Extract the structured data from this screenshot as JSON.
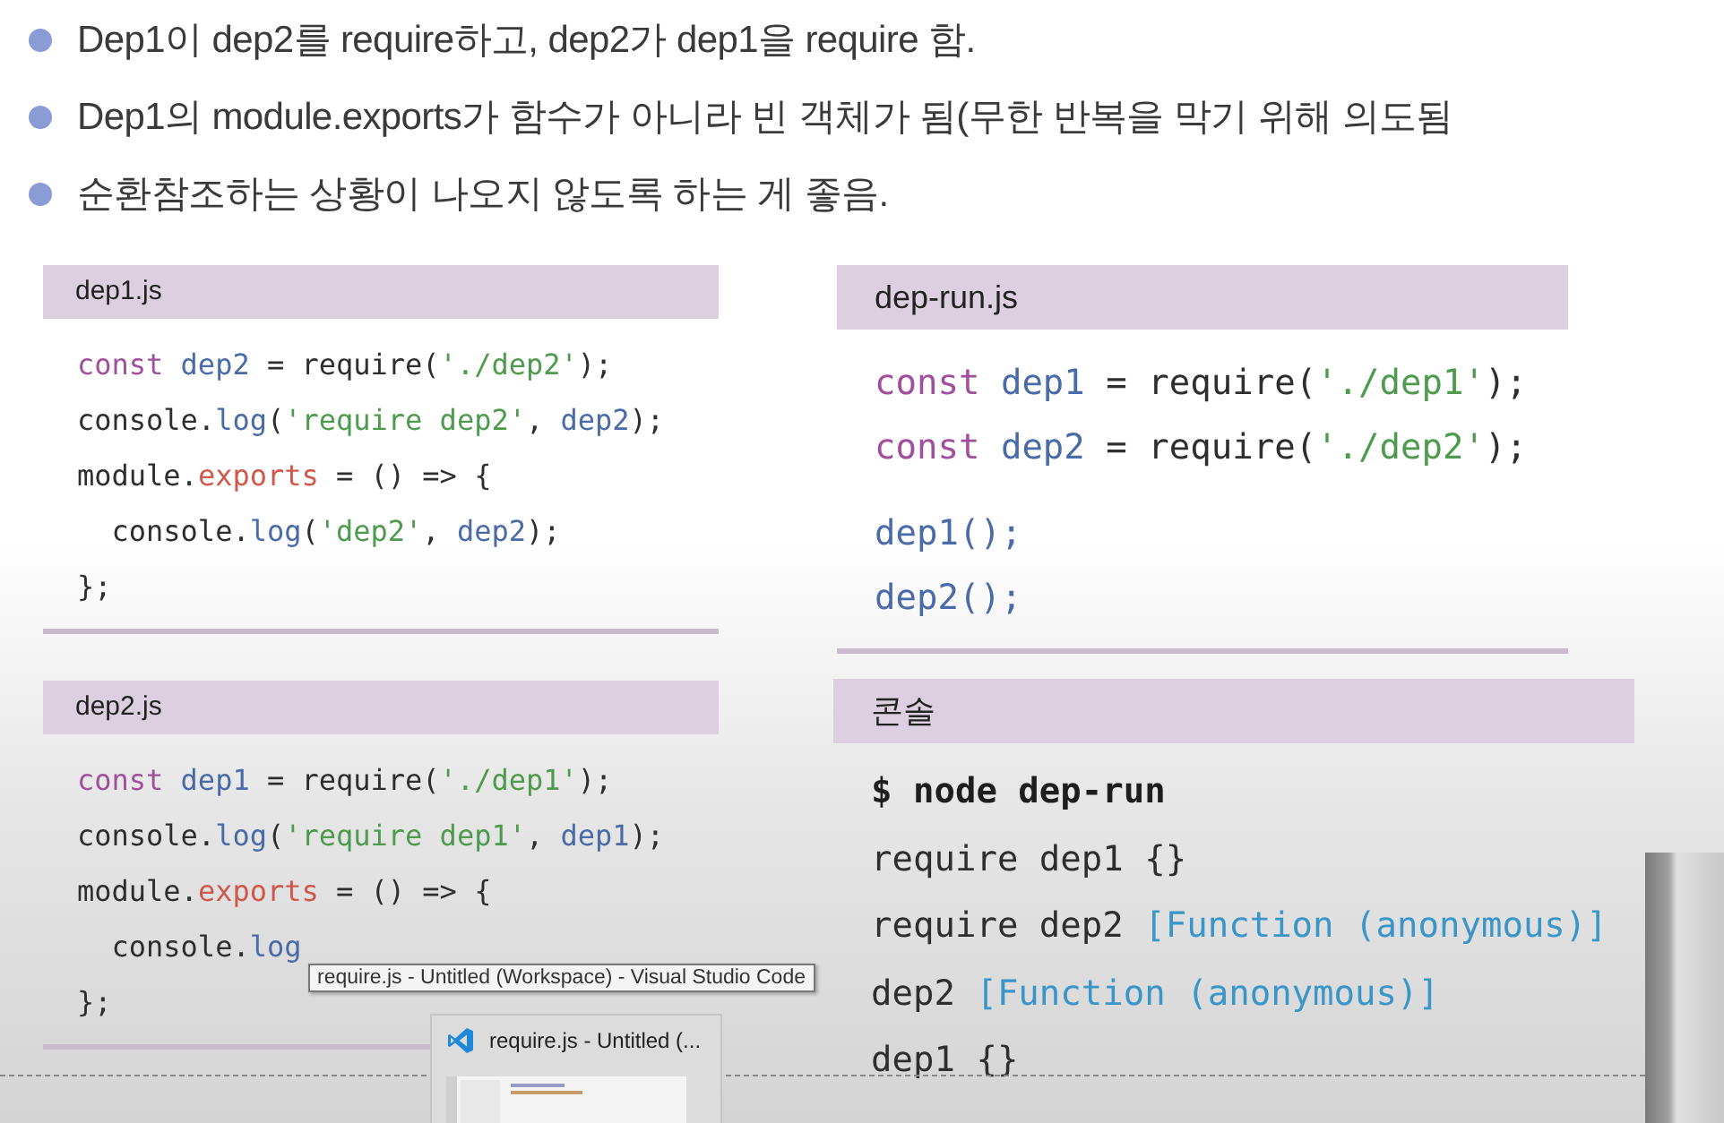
{
  "bullets": [
    "Dep1이 dep2를 require하고, dep2가 dep1을 require 함.",
    "Dep1의 module.exports가 함수가 아니라 빈 객체가 됨(무한 반복을 막기 위해 의도됨",
    "순환참조하는 상황이 나오지 않도록 하는 게 좋음."
  ],
  "left_panels": [
    {
      "title": "dep1.js",
      "lines": [
        [
          {
            "t": "const ",
            "kind": "kw"
          },
          {
            "t": "dep2",
            "kind": "var"
          },
          {
            "t": " = require(",
            "kind": "plain"
          },
          {
            "t": "'./dep2'",
            "kind": "str"
          },
          {
            "t": ");",
            "kind": "plain"
          }
        ],
        [
          {
            "t": "console.",
            "kind": "plain"
          },
          {
            "t": "log",
            "kind": "var"
          },
          {
            "t": "(",
            "kind": "plain"
          },
          {
            "t": "'require dep2'",
            "kind": "str"
          },
          {
            "t": ", ",
            "kind": "plain"
          },
          {
            "t": "dep2",
            "kind": "var"
          },
          {
            "t": ");",
            "kind": "plain"
          }
        ],
        [
          {
            "t": "module.",
            "kind": "plain"
          },
          {
            "t": "exports",
            "kind": "prop"
          },
          {
            "t": " = () => {",
            "kind": "plain"
          }
        ],
        [
          {
            "t": "  console.",
            "kind": "plain"
          },
          {
            "t": "log",
            "kind": "var"
          },
          {
            "t": "(",
            "kind": "plain"
          },
          {
            "t": "'dep2'",
            "kind": "str"
          },
          {
            "t": ", ",
            "kind": "plain"
          },
          {
            "t": "dep2",
            "kind": "var"
          },
          {
            "t": ");",
            "kind": "plain"
          }
        ],
        [
          {
            "t": "};",
            "kind": "plain"
          }
        ]
      ]
    },
    {
      "title": "dep2.js",
      "lines": [
        [
          {
            "t": "const ",
            "kind": "kw"
          },
          {
            "t": "dep1",
            "kind": "var"
          },
          {
            "t": " = require(",
            "kind": "plain"
          },
          {
            "t": "'./dep1'",
            "kind": "str"
          },
          {
            "t": ");",
            "kind": "plain"
          }
        ],
        [
          {
            "t": "console.",
            "kind": "plain"
          },
          {
            "t": "log",
            "kind": "var"
          },
          {
            "t": "(",
            "kind": "plain"
          },
          {
            "t": "'require dep1'",
            "kind": "str"
          },
          {
            "t": ", ",
            "kind": "plain"
          },
          {
            "t": "dep1",
            "kind": "var"
          },
          {
            "t": ");",
            "kind": "plain"
          }
        ],
        [
          {
            "t": "module.",
            "kind": "plain"
          },
          {
            "t": "exports",
            "kind": "prop"
          },
          {
            "t": " = () => {",
            "kind": "plain"
          }
        ],
        [
          {
            "t": "  console.",
            "kind": "plain"
          },
          {
            "t": "log",
            "kind": "var"
          }
        ],
        [
          {
            "t": "};",
            "kind": "plain"
          }
        ]
      ]
    }
  ],
  "right_panels": [
    {
      "title": "dep-run.js",
      "lines": [
        [
          {
            "t": "const ",
            "kind": "kw"
          },
          {
            "t": "dep1",
            "kind": "var"
          },
          {
            "t": " = require(",
            "kind": "plain"
          },
          {
            "t": "'./dep1'",
            "kind": "str"
          },
          {
            "t": ");",
            "kind": "plain"
          }
        ],
        [
          {
            "t": "const ",
            "kind": "kw"
          },
          {
            "t": "dep2",
            "kind": "var"
          },
          {
            "t": " = require(",
            "kind": "plain"
          },
          {
            "t": "'./dep2'",
            "kind": "str"
          },
          {
            "t": ");",
            "kind": "plain"
          }
        ],
        [
          {
            "t": "dep1();",
            "kind": "var"
          }
        ],
        [
          {
            "t": "dep2();",
            "kind": "var"
          }
        ]
      ]
    },
    {
      "title": "콘솔",
      "lines": [
        [
          {
            "t": "$ node dep-run",
            "kind": "cmd"
          }
        ],
        [
          {
            "t": "require dep1 {}",
            "kind": "plain"
          }
        ],
        [
          {
            "t": "require dep2 ",
            "kind": "plain"
          },
          {
            "t": "[Function (anonymous)]",
            "kind": "out"
          }
        ],
        [
          {
            "t": "dep2 ",
            "kind": "plain"
          },
          {
            "t": "[Function (anonymous)]",
            "kind": "out"
          }
        ],
        [
          {
            "t": "dep1 {}",
            "kind": "plain"
          }
        ]
      ]
    }
  ],
  "tooltip": "require.js - Untitled (Workspace) - Visual Studio Code",
  "thumbnail": {
    "title": "require.js - Untitled (..."
  }
}
